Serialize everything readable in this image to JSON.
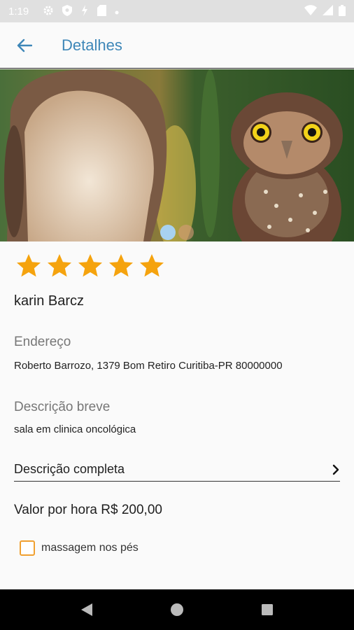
{
  "status_bar": {
    "time": "1:19"
  },
  "app_bar": {
    "title": "Detalhes"
  },
  "carousel": {
    "slide_count": 2,
    "active_index": 0
  },
  "listing": {
    "rating": 5,
    "rating_max": 5,
    "name": "karin Barcz",
    "address_label": "Endereço",
    "address_value": "Roberto Barrozo, 1379 Bom Retiro Curitiba-PR 80000000",
    "short_desc_label": "Descrição breve",
    "short_desc_value": "sala em clinica oncológica",
    "full_desc_label": "Descrição completa",
    "price": "Valor por hora R$ 200,00",
    "extra_option": {
      "label": "massagem nos pés",
      "checked": false
    }
  },
  "colors": {
    "accent": "#3e87b8",
    "star": "#f5a30e",
    "checkbox_border": "#f0a030"
  }
}
